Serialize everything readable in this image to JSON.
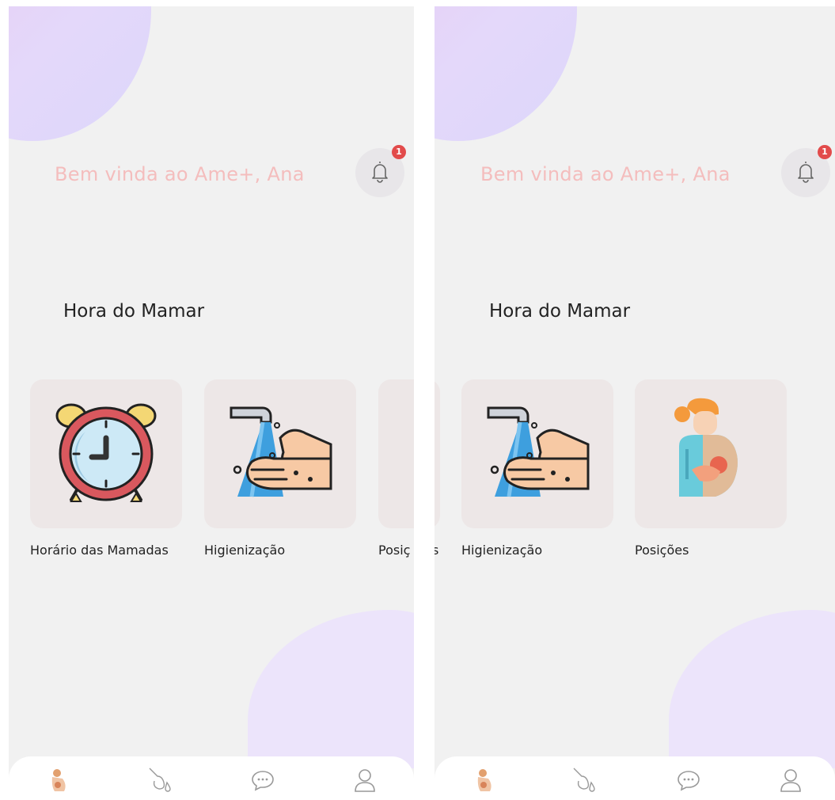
{
  "screens": [
    {
      "greeting": "Bem vinda ao Ame+, Ana",
      "notifications": {
        "count": "1"
      },
      "section_title": "Hora do Mamar",
      "cards": [
        {
          "label": "Horário das Mamadas",
          "icon": "alarm-clock-icon"
        },
        {
          "label": "Higienização",
          "icon": "hand-washing-icon"
        },
        {
          "label": "Posiç",
          "icon": "breastfeeding-icon"
        }
      ]
    },
    {
      "greeting": "Bem vinda ao Ame+, Ana",
      "notifications": {
        "count": "1"
      },
      "section_title": "Hora do Mamar",
      "cards": [
        {
          "label": "s",
          "icon": "alarm-clock-icon"
        },
        {
          "label": "Higienização",
          "icon": "hand-washing-icon"
        },
        {
          "label": "Posições",
          "icon": "breastfeeding-icon"
        }
      ]
    }
  ],
  "nav": [
    "home-icon",
    "breast-pump-icon",
    "chat-icon",
    "profile-icon"
  ],
  "colors": {
    "background": "#f1f1f1",
    "greeting": "#f4bdbd",
    "badge": "#e24b4b",
    "card": "#ede7e7",
    "blob": "#ece4fb"
  }
}
